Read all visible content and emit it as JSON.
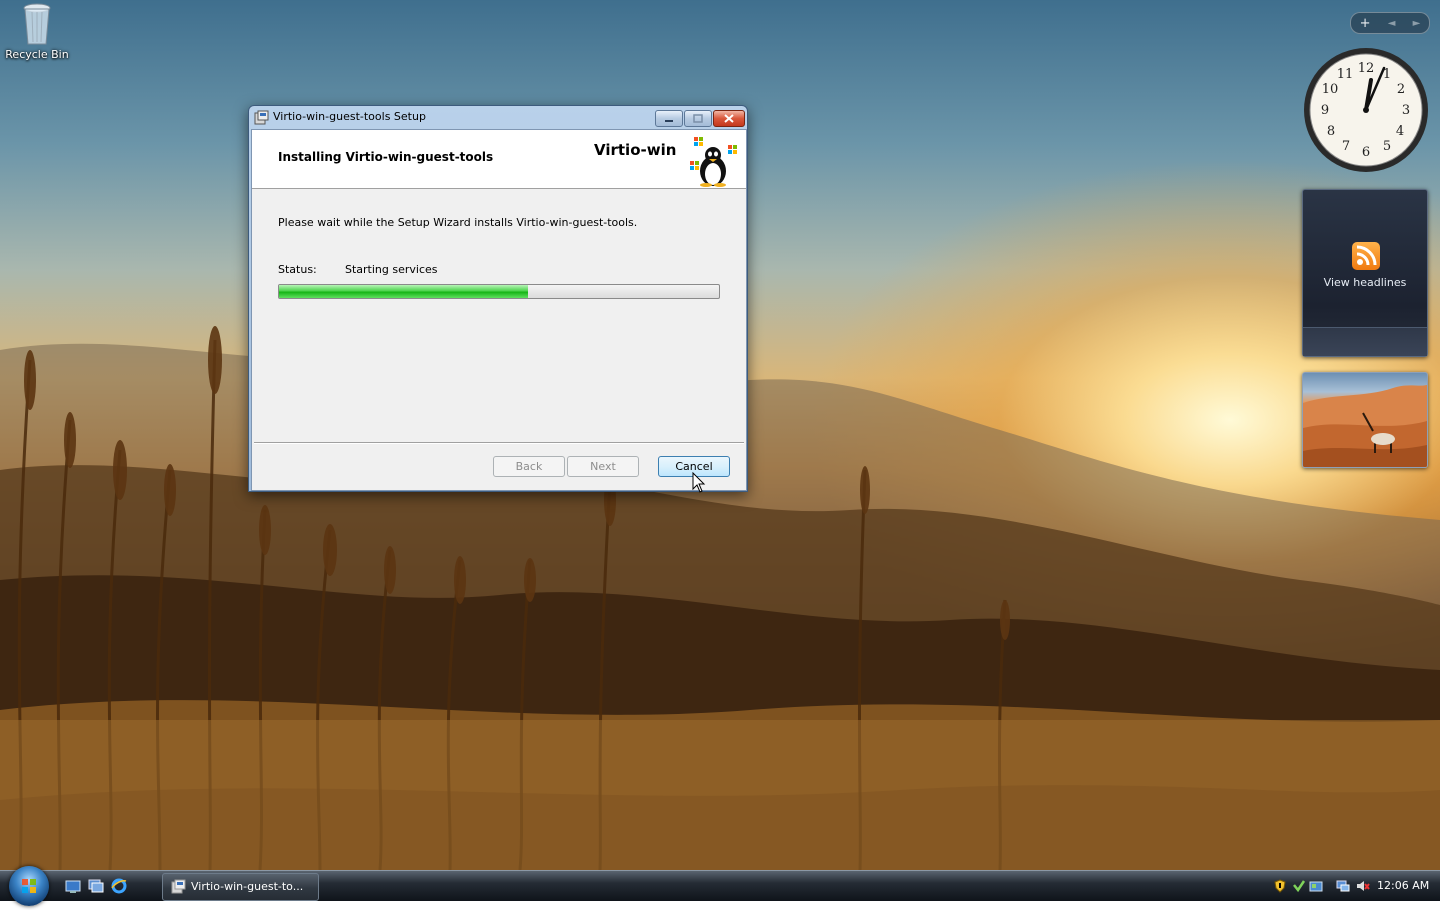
{
  "desktop": {
    "icons": [
      {
        "label": "Recycle Bin",
        "icon": "recycle-bin-icon"
      }
    ]
  },
  "sidebar_gadgets": {
    "toolbar": {
      "add": "+",
      "prev": "◄",
      "next": "►"
    },
    "clock": {
      "time": "12:06"
    },
    "feed": {
      "label": "View headlines",
      "icon": "rss-icon"
    },
    "slideshow": {
      "subject": "desert-oryx"
    }
  },
  "installer": {
    "title": "Virtio-win-guest-tools Setup",
    "heading": "Installing Virtio-win-guest-tools",
    "brand": "Virtio-win",
    "description": "Please wait while the Setup Wizard installs Virtio-win-guest-tools.",
    "status_label": "Status:",
    "status_value": "Starting services",
    "progress_fraction": 0.565,
    "buttons": {
      "back": "Back",
      "next": "Next",
      "cancel": "Cancel"
    }
  },
  "taskbar": {
    "quick_launch": [
      "show-desktop-icon",
      "switch-windows-icon",
      "internet-explorer-icon"
    ],
    "task_label": "Virtio-win-guest-to...",
    "clock": "12:06 AM"
  },
  "colors": {
    "accent": "#3c7fb1",
    "progress": "#16b516",
    "close": "#c4381c"
  }
}
